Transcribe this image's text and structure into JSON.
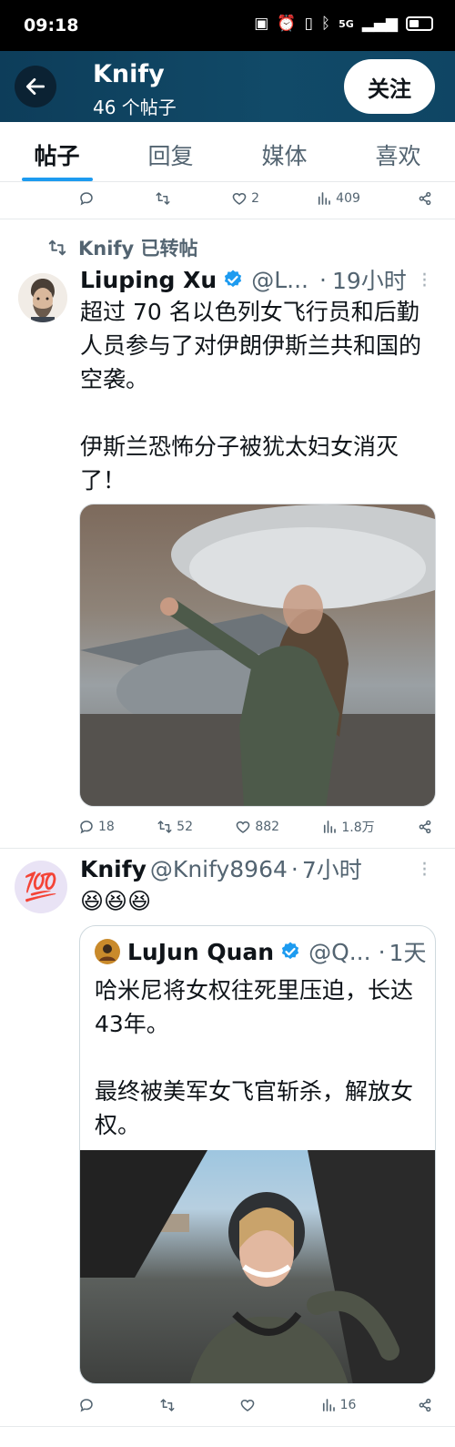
{
  "status_bar": {
    "time": "09:18",
    "network": "5G"
  },
  "header": {
    "title": "Knify",
    "subtitle": "46 个帖子",
    "follow_label": "关注"
  },
  "tabs": [
    {
      "label": "帖子",
      "active": true
    },
    {
      "label": "回复",
      "active": false
    },
    {
      "label": "媒体",
      "active": false
    },
    {
      "label": "喜欢",
      "active": false
    }
  ],
  "top_actions": {
    "reply": "",
    "repost": "",
    "like": "2",
    "views": "409"
  },
  "post1": {
    "repost_label": "Knify 已转帖",
    "name": "Liuping Xu",
    "handle": "@L...",
    "dot": "·",
    "time": "19小时",
    "text": "超过 70 名以色列女飞行员和后勤人员参与了对伊朗伊斯兰共和国的空袭。\n\n伊斯兰恐怖分子被犹太妇女消灭了！",
    "actions": {
      "reply": "18",
      "repost": "52",
      "like": "882",
      "views": "1.8万"
    }
  },
  "post2": {
    "name": "Knify",
    "handle": "@Knify8964",
    "dot": "·",
    "time": "7小时",
    "text": "😆😆😆",
    "avatar_emoji": "💯",
    "quote": {
      "name": "LuJun Quan",
      "handle": "@Q...",
      "dot": "·",
      "time": "1天",
      "text": "哈米尼将女权往死里压迫，长达43年。\n\n最终被美军女飞官斩杀，解放女权。"
    },
    "actions": {
      "reply": "",
      "repost": "",
      "like": "",
      "views": "16"
    }
  },
  "colors": {
    "accent": "#1d9bf0",
    "header_bg": "#114a68",
    "muted": "#536471"
  }
}
